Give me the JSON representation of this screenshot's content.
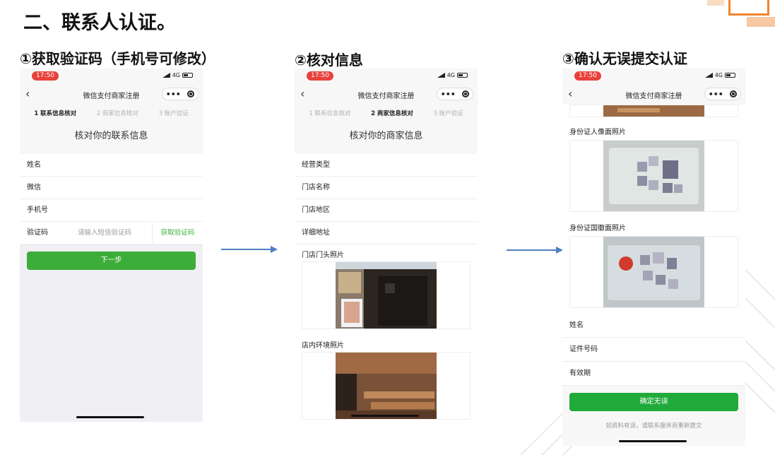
{
  "page": {
    "title": "二、联系人认证。",
    "step1_title": "①获取验证码（手机号可修改）",
    "step2_title": "②核对信息",
    "step3_title": "③确认无误提交认证"
  },
  "colors": {
    "accent_green": "#3dad3a",
    "status_red": "#e8413c",
    "link_green": "#3cb034",
    "arrow_blue": "#4f7fc0",
    "deco_orange": "#f0852d"
  },
  "phone": {
    "time": "17:50",
    "network": "4G",
    "nav_title": "微信支付商家注册",
    "more_label": "•••",
    "steps": [
      "1 联系信息核对",
      "2 商家信息核对",
      "3 账户验证"
    ]
  },
  "screen1": {
    "heading": "核对你的联系信息",
    "fields": [
      "姓名",
      "微信",
      "手机号"
    ],
    "code_label": "验证码",
    "code_placeholder": "请输入短信验证码",
    "get_code": "获取验证码",
    "next": "下一步"
  },
  "screen2": {
    "heading": "核对你的商家信息",
    "fields": [
      "经营类型",
      "门店名称",
      "门店地区",
      "详细地址"
    ],
    "storefront_photo": "门店门头照片",
    "interior_photo": "店内环境照片"
  },
  "screen3": {
    "id_front": "身份证人像面照片",
    "id_back": "身份证国徽面照片",
    "fields": [
      "姓名",
      "证件号码",
      "有效期"
    ],
    "confirm": "确定无误",
    "note": "如资料有误，请联系服务商重新提交"
  }
}
